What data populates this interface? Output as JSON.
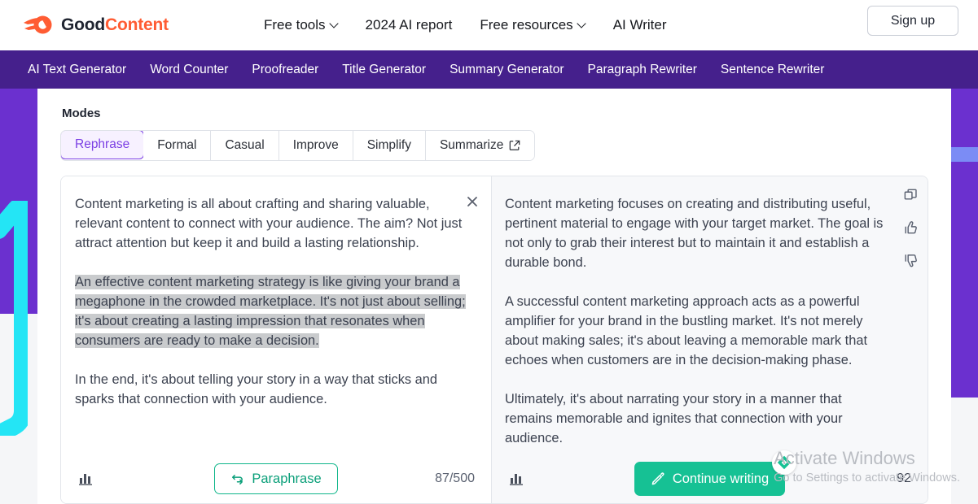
{
  "brand": {
    "first": "Good",
    "second": "Content",
    "logo_icon": "comet-logo-icon"
  },
  "header": {
    "nav": [
      {
        "label": "Free tools",
        "has_caret": true
      },
      {
        "label": "2024 AI report",
        "has_caret": false
      },
      {
        "label": "Free resources",
        "has_caret": true
      },
      {
        "label": "AI Writer",
        "has_caret": false
      }
    ],
    "signup_label": "Sign up"
  },
  "tools_nav": {
    "items": [
      "AI Text Generator",
      "Word Counter",
      "Proofreader",
      "Title Generator",
      "Summary Generator",
      "Paragraph Rewriter",
      "Sentence Rewriter"
    ]
  },
  "modes": {
    "label": "Modes",
    "options": [
      {
        "label": "Rephrase",
        "active": true,
        "external": false
      },
      {
        "label": "Formal",
        "active": false,
        "external": false
      },
      {
        "label": "Casual",
        "active": false,
        "external": false
      },
      {
        "label": "Improve",
        "active": false,
        "external": false
      },
      {
        "label": "Simplify",
        "active": false,
        "external": false
      },
      {
        "label": "Summarize",
        "active": false,
        "external": true
      }
    ]
  },
  "editor": {
    "left": {
      "paragraphs": [
        "Content marketing is all about crafting and sharing valuable, relevant content to connect with your audience. The aim? Not just attract attention but keep it and build a lasting relationship.",
        "An effective content marketing strategy is like giving your brand a megaphone in the crowded marketplace. It's not just about selling; it's about creating a lasting impression that resonates when consumers are ready to make a decision.",
        "In the end, it's about telling your story in a way that sticks and sparks that connection with your audience."
      ],
      "highlighted_index": 1,
      "close_icon": "close-icon",
      "stats_icon": "stats-bar-icon",
      "action_label": "Paraphrase",
      "action_icon": "refresh-arrows-icon",
      "counter": "87/500"
    },
    "right": {
      "paragraphs": [
        "Content marketing focuses on creating and distributing useful, pertinent material to engage with your target market. The goal is not only to grab their interest but to maintain it and establish a durable bond.",
        "A successful content marketing approach acts as a powerful amplifier for your brand in the bustling market. It's not merely about making sales; it's about leaving a memorable mark that echoes when customers are in the decision-making phase.",
        "Ultimately, it's about narrating your story in a manner that remains memorable and ignites that connection with your audience."
      ],
      "rail_icons": [
        "copy-icon",
        "thumbs-up-icon",
        "thumbs-down-icon"
      ],
      "stats_icon": "stats-bar-icon",
      "action_label": "Continue writing",
      "action_icon": "pencil-icon",
      "badge_icon": "ai-diamond-icon",
      "counter": "92"
    }
  },
  "watermark": {
    "title": "Activate Windows",
    "subtitle": "Go to Settings to activate Windows."
  },
  "colors": {
    "brand_orange": "#ff5c33",
    "nav_purple": "#45208c",
    "band_purple": "#6b30cf",
    "band_blue": "#7b8cf5",
    "accent_purple": "#7b3fe4",
    "teal": "#0fb68a",
    "green": "#16c194",
    "cyan_deco": "#24e5f5"
  }
}
